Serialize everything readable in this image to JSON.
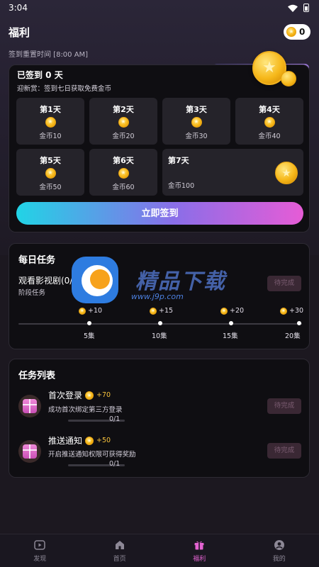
{
  "status_bar": {
    "time": "3:04"
  },
  "header": {
    "title": "福利",
    "coin_balance": "0"
  },
  "reset_time": "签到重置时间 [8:00 AM]",
  "signin": {
    "title": "已签到 0 天",
    "subtitle": "迎新赏：签到七日获取免费金币",
    "days": [
      {
        "label": "第1天",
        "reward": "金币10"
      },
      {
        "label": "第2天",
        "reward": "金币20"
      },
      {
        "label": "第3天",
        "reward": "金币30"
      },
      {
        "label": "第4天",
        "reward": "金币40"
      },
      {
        "label": "第5天",
        "reward": "金币50"
      },
      {
        "label": "第6天",
        "reward": "金币60"
      },
      {
        "label": "第7天",
        "reward": "金币100"
      }
    ],
    "button": "立即签到"
  },
  "daily": {
    "title": "每日任务",
    "task_name": "观看影视剧(0/2",
    "task_sub": "阶段任务",
    "button": "待完成",
    "milestones": [
      {
        "reward": "+10",
        "label": "5集"
      },
      {
        "reward": "+15",
        "label": "10集"
      },
      {
        "reward": "+20",
        "label": "15集"
      },
      {
        "reward": "+30",
        "label": "20集"
      }
    ]
  },
  "watermark": {
    "text": "精品下载",
    "url": "www.j9p.com"
  },
  "tasklist": {
    "title": "任务列表",
    "items": [
      {
        "title": "首次登录",
        "points": "+70",
        "desc": "成功首次绑定第三方登录",
        "count": "0/1",
        "button": "待完成"
      },
      {
        "title": "推送通知",
        "points": "+50",
        "desc": "开启推送通知权限可获得奖励",
        "count": "0/1",
        "button": "待完成"
      }
    ]
  },
  "nav": [
    {
      "label": "发现",
      "icon": "play-icon"
    },
    {
      "label": "首页",
      "icon": "home-icon"
    },
    {
      "label": "福利",
      "icon": "gift-icon"
    },
    {
      "label": "我的",
      "icon": "profile-icon"
    }
  ],
  "colors": {
    "accent_start": "#21d4e6",
    "accent_end": "#e65cd6",
    "active_tab": "#e463d2",
    "coin": "#f6b81a"
  }
}
